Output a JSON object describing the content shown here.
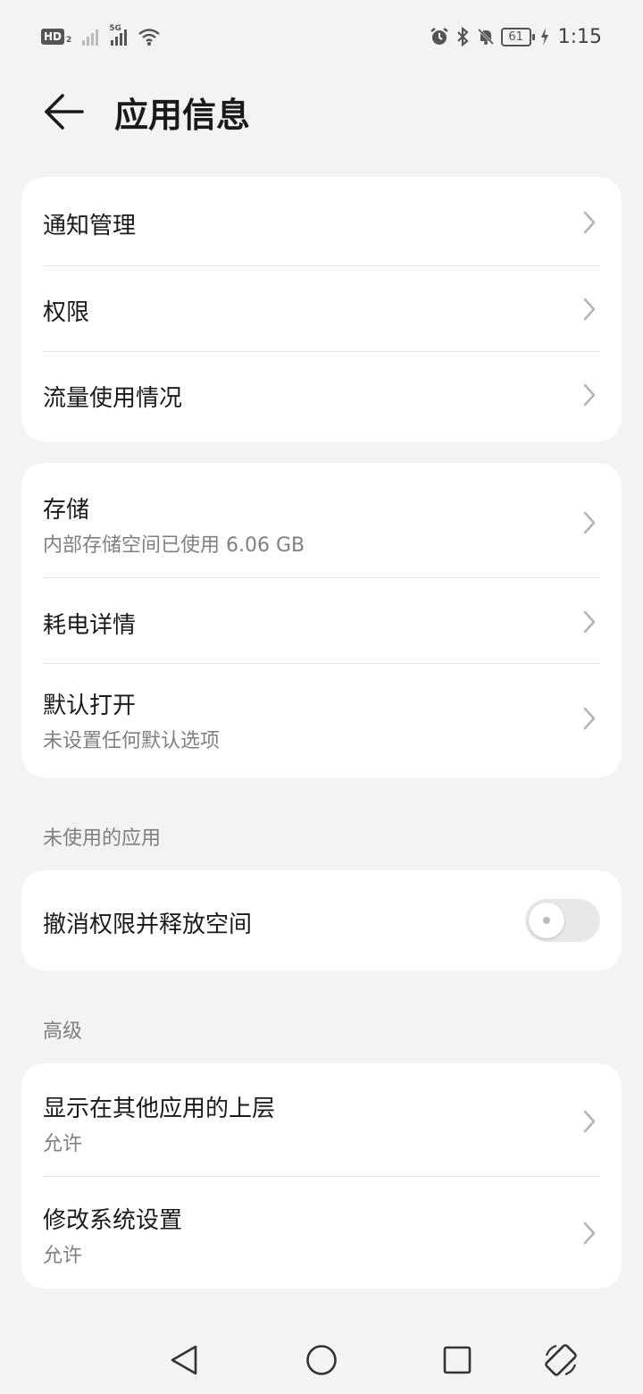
{
  "status_bar": {
    "hd_label": "HD",
    "hd_sub": "2",
    "net_type": "5G",
    "battery": "61",
    "time": "1:15",
    "icons": [
      "alarm-icon",
      "bluetooth-icon",
      "mute-icon",
      "charging-icon",
      "wifi-icon"
    ]
  },
  "header": {
    "title": "应用信息"
  },
  "group1": {
    "items": [
      {
        "title": "通知管理"
      },
      {
        "title": "权限"
      },
      {
        "title": "流量使用情况"
      }
    ]
  },
  "group2": {
    "items": [
      {
        "title": "存储",
        "subtitle": "内部存储空间已使用 6.06 GB"
      },
      {
        "title": "耗电详情"
      },
      {
        "title": "默认打开",
        "subtitle": "未设置任何默认选项"
      }
    ]
  },
  "unused_section": {
    "label": "未使用的应用",
    "toggle_item": {
      "title": "撤消权限并释放空间",
      "enabled": false
    }
  },
  "advanced_section": {
    "label": "高级",
    "items": [
      {
        "title": "显示在其他应用的上层",
        "subtitle": "允许"
      },
      {
        "title": "修改系统设置",
        "subtitle": "允许"
      }
    ]
  },
  "nav_bar": {
    "buttons": [
      "back-triangle-icon",
      "home-circle-icon",
      "recents-square-icon",
      "rotate-icon"
    ]
  },
  "colors": {
    "background": "#f1f3f5",
    "card": "#ffffff",
    "primary_text": "#1a1a1a",
    "secondary_text": "#808080"
  }
}
